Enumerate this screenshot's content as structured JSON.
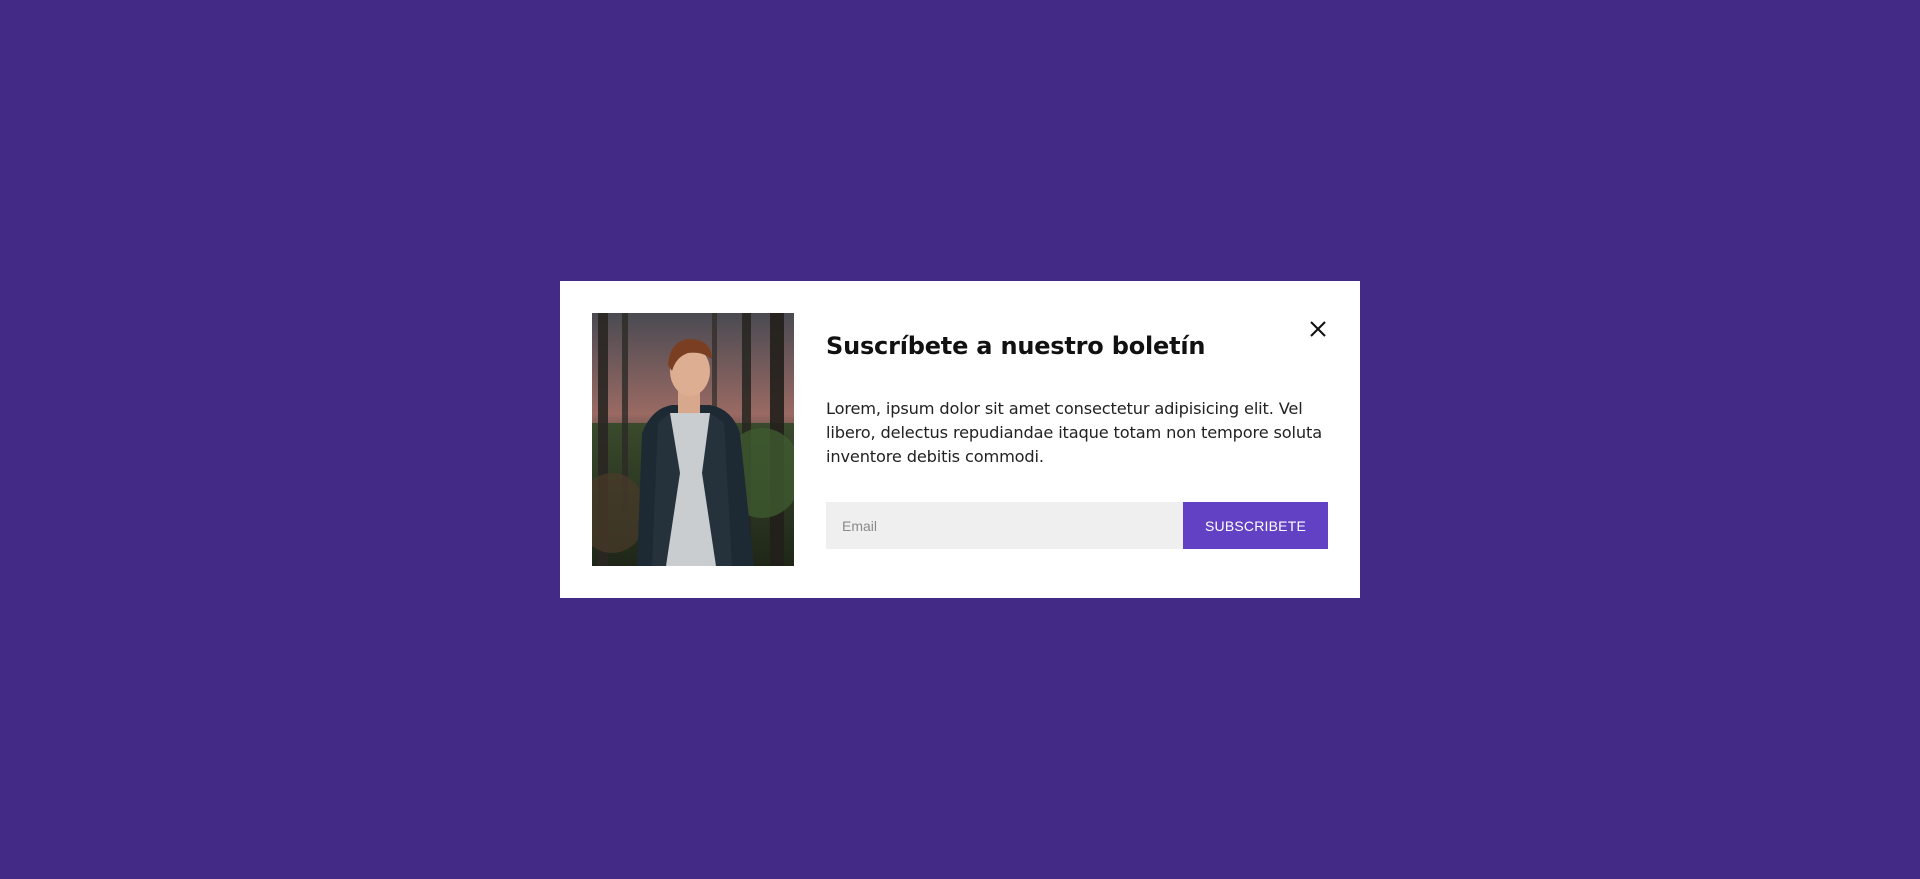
{
  "theme": {
    "background": "#442a87",
    "modal_background": "#ffffff",
    "accent": "#6341c4",
    "input_background": "#efefef"
  },
  "modal": {
    "image_icon": "person-photo",
    "close_icon": "close-icon",
    "title": "Suscríbete a nuestro boletín",
    "description": "Lorem, ipsum dolor sit amet consectetur adipisicing elit. Vel libero, delectus repudiandae itaque totam non tempore soluta inventore debitis commodi.",
    "email": {
      "value": "",
      "placeholder": "Email"
    },
    "subscribe_label": "SUBSCRIBETE"
  }
}
